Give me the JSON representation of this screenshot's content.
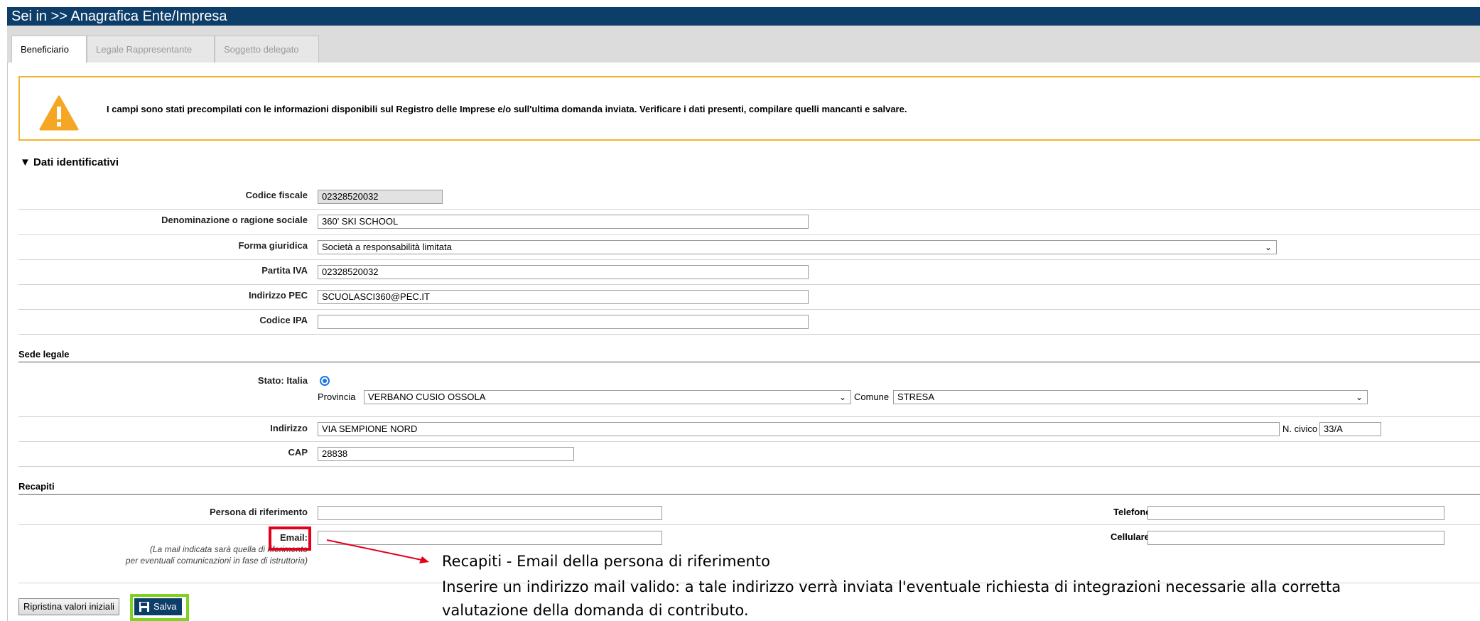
{
  "header": {
    "breadcrumb": "Sei in >> Anagrafica Ente/Impresa"
  },
  "tabs": [
    {
      "label": "Beneficiario"
    },
    {
      "label": "Legale Rappresentante"
    },
    {
      "label": "Soggetto delegato"
    }
  ],
  "warning": {
    "icon": "warning-triangle-icon",
    "text": "I campi sono stati precompilati con le informazioni disponibili sul Registro delle Imprese e/o sull'ultima domanda inviata. Verificare i dati presenti, compilare quelli mancanti e salvare."
  },
  "dati": {
    "title": "▼ Dati identificativi",
    "codice_fiscale": {
      "label": "Codice fiscale",
      "value": "02328520032"
    },
    "denominazione": {
      "label": "Denominazione o ragione sociale",
      "value": "360' SKI SCHOOL"
    },
    "forma_giuridica": {
      "label": "Forma giuridica",
      "value": "Società a responsabilità limitata"
    },
    "partita_iva": {
      "label": "Partita IVA",
      "value": "02328520032"
    },
    "pec": {
      "label": "Indirizzo PEC",
      "value": "SCUOLASCI360@PEC.IT"
    },
    "ipa": {
      "label": "Codice IPA",
      "value": ""
    }
  },
  "sede": {
    "title": "Sede legale",
    "stato_label": "Stato: Italia",
    "provincia_label": "Provincia",
    "provincia_value": "VERBANO CUSIO OSSOLA",
    "comune_label": "Comune",
    "comune_value": "STRESA",
    "indirizzo": {
      "label": "Indirizzo",
      "value": "VIA SEMPIONE NORD"
    },
    "civico": {
      "label": "N. civico",
      "value": "33/A"
    },
    "cap": {
      "label": "CAP",
      "value": "28838"
    }
  },
  "recapiti": {
    "title": "Recapiti",
    "persona": {
      "label": "Persona di riferimento",
      "value": ""
    },
    "telefono": {
      "label": "Telefono",
      "value": ""
    },
    "email": {
      "label": "Email:",
      "value": ""
    },
    "email_note_1": "(La mail indicata sarà quella di riferimento",
    "email_note_2": "per eventuali comunicazioni in fase di istruttoria)",
    "cellulare": {
      "label": "Cellulare",
      "value": ""
    }
  },
  "buttons": {
    "reset": "Ripristina valori iniziali",
    "save": "Salva"
  },
  "callout": {
    "line1": "Recapiti - Email della persona di riferimento",
    "line2": "Inserire un indirizzo mail valido: a tale indirizzo verrà inviata l'eventuale richiesta di integrazioni necessarie alla corretta",
    "line3": "valutazione della domanda di contributo."
  },
  "colors": {
    "header": "#0d3e6a",
    "warning_border": "#f2b32f",
    "highlight_red": "#e3001b",
    "highlight_green": "#7ed321"
  }
}
